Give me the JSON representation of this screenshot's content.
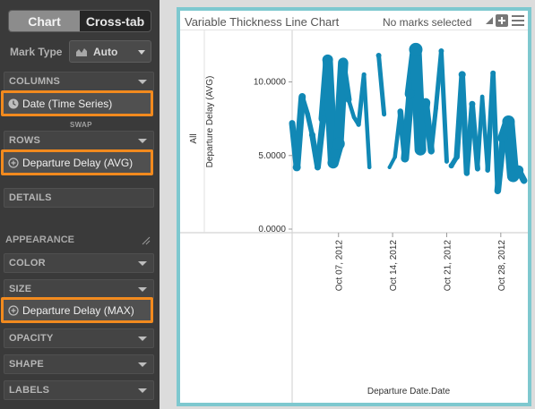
{
  "sidebar": {
    "toggle": {
      "chart": "Chart",
      "crosstab": "Cross-tab"
    },
    "mark_type": {
      "label": "Mark Type",
      "value": "Auto"
    },
    "columns": {
      "label": "COLUMNS",
      "pill": "Date (Time Series)"
    },
    "swap": "SWAP",
    "rows": {
      "label": "ROWS",
      "pill": "Departure Delay (AVG)"
    },
    "details": "DETAILS",
    "appearance": "APPEARANCE",
    "color": "COLOR",
    "size": {
      "label": "SIZE",
      "pill": "Departure Delay (MAX)"
    },
    "opacity": "OPACITY",
    "shape": "SHAPE",
    "labels": "LABELS"
  },
  "panel": {
    "title": "Variable Thickness Line Chart",
    "status": "No marks selected"
  },
  "colors": {
    "accent_orange": "#f28a1e",
    "panel_border": "#7ec8cf",
    "series": "#1188b5"
  },
  "chart_data": {
    "type": "line",
    "row_header": "All",
    "ylabel": "Departure Delay (AVG)",
    "xlabel": "Departure Date.Date",
    "ylim": [
      0,
      13.5
    ],
    "y_ticks": [
      "0.0000",
      "5.0000",
      "10.0000"
    ],
    "x_ticks": [
      "Oct 07, 2012",
      "Oct 14, 2012",
      "Oct 21, 2012",
      "Oct 28, 2012"
    ],
    "x_tick_days": [
      7,
      14,
      21,
      28
    ],
    "xlim_days": [
      1,
      31.5
    ],
    "segments": [
      [
        [
          1.0,
          7.2,
          5
        ],
        [
          1.6,
          4.2,
          9
        ],
        [
          2.3,
          9.0,
          7
        ],
        [
          3.0,
          7.8,
          4
        ],
        [
          3.6,
          6.4,
          7
        ],
        [
          4.3,
          4.2,
          6
        ],
        [
          5.0,
          7.5,
          8
        ],
        [
          5.6,
          11.5,
          12
        ],
        [
          6.3,
          4.5,
          11
        ],
        [
          7.0,
          5.8,
          14
        ],
        [
          7.6,
          11.3,
          9
        ],
        [
          8.3,
          8.8,
          5
        ],
        [
          9.0,
          7.6,
          4
        ],
        [
          9.6,
          7.1,
          5
        ],
        [
          10.3,
          10.5,
          5
        ],
        [
          11.0,
          4.2,
          4
        ]
      ],
      [
        [
          12.2,
          11.8,
          6
        ],
        [
          12.9,
          7.8,
          4
        ]
      ],
      [
        [
          13.6,
          4.2,
          4
        ],
        [
          14.3,
          4.9,
          4
        ],
        [
          15.0,
          8.0,
          5
        ],
        [
          15.6,
          4.8,
          8
        ],
        [
          16.3,
          9.2,
          10
        ],
        [
          17.0,
          12.2,
          15
        ],
        [
          17.6,
          5.4,
          11
        ],
        [
          18.3,
          8.6,
          9
        ],
        [
          19.0,
          5.3,
          6
        ],
        [
          19.6,
          8.2,
          4
        ],
        [
          20.3,
          12.1,
          6
        ],
        [
          21.0,
          4.6,
          4
        ]
      ],
      [
        [
          21.6,
          4.3,
          6
        ],
        [
          22.3,
          4.9,
          5
        ],
        [
          23.0,
          10.5,
          8
        ],
        [
          23.6,
          3.8,
          5
        ],
        [
          24.3,
          8.5,
          7
        ],
        [
          25.0,
          4.1,
          5
        ],
        [
          25.6,
          9.0,
          4
        ],
        [
          26.3,
          4.0,
          5
        ],
        [
          27.0,
          10.6,
          6
        ],
        [
          27.6,
          2.6,
          5
        ],
        [
          28.3,
          6.2,
          10
        ],
        [
          29.0,
          7.3,
          14
        ],
        [
          29.6,
          3.6,
          13
        ],
        [
          30.3,
          4.0,
          9
        ],
        [
          31.0,
          3.3,
          6
        ]
      ]
    ]
  }
}
